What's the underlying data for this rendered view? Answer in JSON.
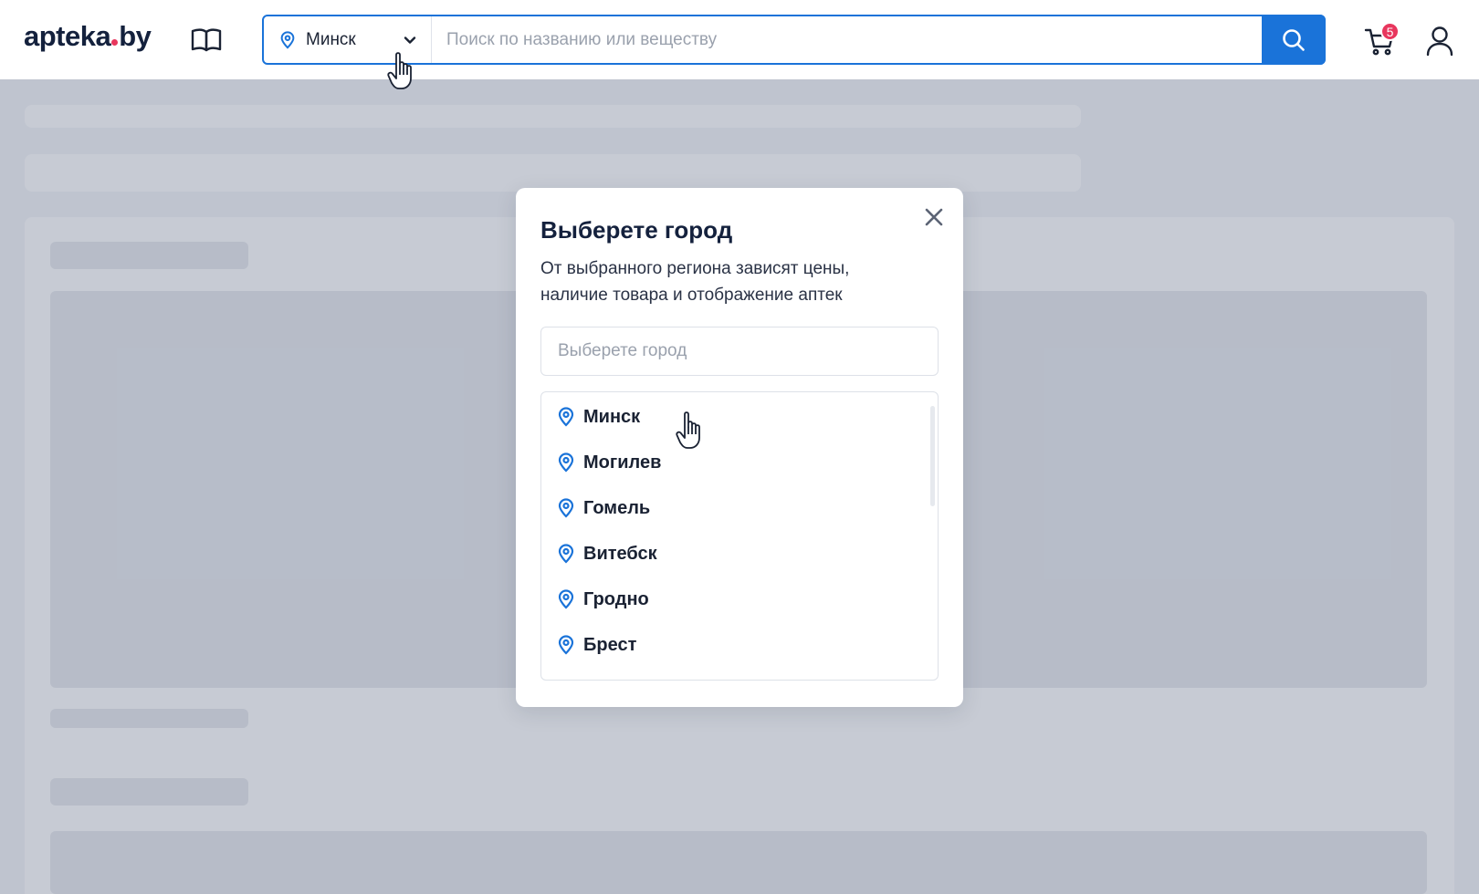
{
  "header": {
    "logo_left": "apteka",
    "logo_right": "by",
    "city_label": "Минск",
    "search_placeholder": "Поиск по названию или веществу",
    "cart_count": "5"
  },
  "modal": {
    "title": "Выберете город",
    "description_line1": "От выбранного региона зависят цены,",
    "description_line2": "наличие товара и отображение аптек",
    "search_placeholder": "Выберете город",
    "cities": [
      {
        "name": "Минск"
      },
      {
        "name": "Могилев"
      },
      {
        "name": "Гомель"
      },
      {
        "name": "Витебск"
      },
      {
        "name": "Гродно"
      },
      {
        "name": "Брест"
      }
    ]
  },
  "icons": {
    "catalog": "open-book-icon",
    "pin": "location-pin-icon",
    "chevron": "chevron-down-icon",
    "search": "search-icon",
    "cart": "shopping-cart-icon",
    "user": "user-icon",
    "close": "close-icon",
    "cursor": "hand-pointer-cursor"
  },
  "colors": {
    "brand_blue": "#1a73d9",
    "brand_dark": "#14213d",
    "accent_red": "#e8365d"
  }
}
